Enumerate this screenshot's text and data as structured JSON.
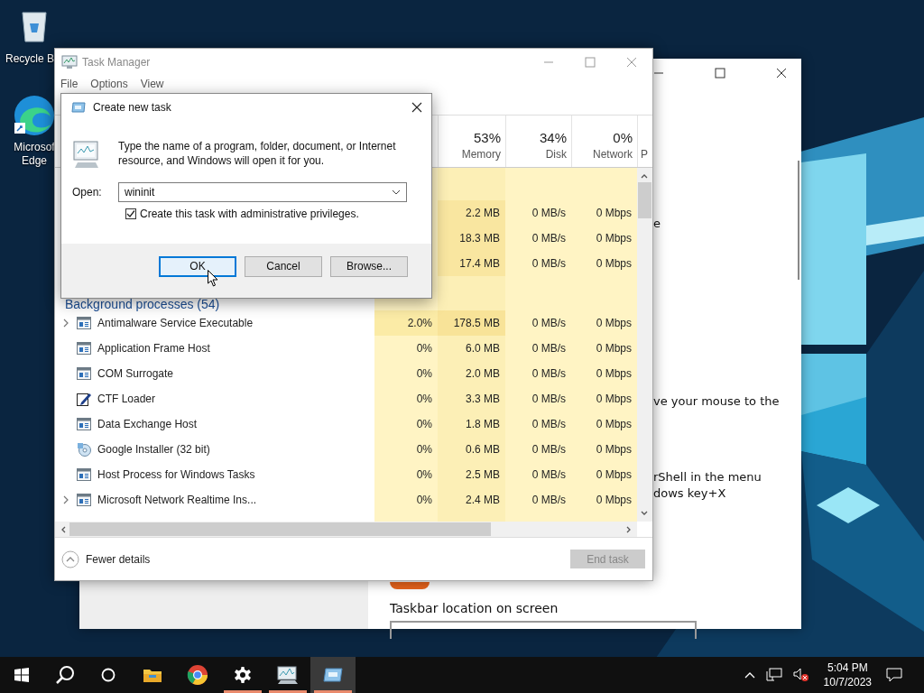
{
  "desktop_icons": [
    {
      "kind": "bin",
      "label": "Recycle B"
    },
    {
      "kind": "browser",
      "label": "Microsof Edge"
    }
  ],
  "settings_window": {
    "line_fragments": [
      "e",
      "ve your mouse to the",
      "rShell in the menu",
      "dows key+X"
    ],
    "toggle": {
      "on": true
    },
    "heading": "Taskbar location on screen"
  },
  "task_manager": {
    "title": "Task Manager",
    "menu": [
      "File",
      "Options",
      "View"
    ],
    "columns": [
      {
        "value": "53%",
        "label": "Memory"
      },
      {
        "value": "34%",
        "label": "Disk"
      },
      {
        "value": "0%",
        "label": "Network"
      },
      {
        "label": "P"
      }
    ],
    "apps_rows": [
      {
        "memory": "2.2 MB",
        "disk": "0 MB/s",
        "network": "0 Mbps"
      },
      {
        "memory": "18.3 MB",
        "disk": "0 MB/s",
        "network": "0 Mbps"
      },
      {
        "memory": "17.4 MB",
        "disk": "0 MB/s",
        "network": "0 Mbps"
      }
    ],
    "group_heading": "Background processes (54)",
    "rows": [
      {
        "name": "Antimalware Service Executable",
        "kind": "window",
        "expandable": true,
        "cpu": "2.0%",
        "memory": "178.5 MB",
        "disk": "0 MB/s",
        "network": "0 Mbps"
      },
      {
        "name": "Application Frame Host",
        "kind": "window",
        "expandable": false,
        "cpu": "0%",
        "memory": "6.0 MB",
        "disk": "0 MB/s",
        "network": "0 Mbps"
      },
      {
        "name": "COM Surrogate",
        "kind": "window",
        "expandable": false,
        "cpu": "0%",
        "memory": "2.0 MB",
        "disk": "0 MB/s",
        "network": "0 Mbps"
      },
      {
        "name": "CTF Loader",
        "kind": "pen",
        "expandable": false,
        "cpu": "0%",
        "memory": "3.3 MB",
        "disk": "0 MB/s",
        "network": "0 Mbps"
      },
      {
        "name": "Data Exchange Host",
        "kind": "window",
        "expandable": false,
        "cpu": "0%",
        "memory": "1.8 MB",
        "disk": "0 MB/s",
        "network": "0 Mbps"
      },
      {
        "name": "Google Installer (32 bit)",
        "kind": "installer",
        "expandable": false,
        "cpu": "0%",
        "memory": "0.6 MB",
        "disk": "0 MB/s",
        "network": "0 Mbps"
      },
      {
        "name": "Host Process for Windows Tasks",
        "kind": "window",
        "expandable": false,
        "cpu": "0%",
        "memory": "2.5 MB",
        "disk": "0 MB/s",
        "network": "0 Mbps"
      },
      {
        "name": "Microsoft Network Realtime Ins...",
        "kind": "window",
        "expandable": true,
        "cpu": "0%",
        "memory": "2.4 MB",
        "disk": "0 MB/s",
        "network": "0 Mbps"
      }
    ],
    "fewer_details": "Fewer details",
    "end_task": {
      "label": "End task",
      "disabled": true
    }
  },
  "dialog": {
    "title": "Create new task",
    "message": "Type the name of a program, folder, document, or Internet resource, and Windows will open it for you.",
    "open_label": "Open:",
    "open_value": "wininit",
    "admin": {
      "label": "Create this task with administrative privileges.",
      "checked": true
    },
    "buttons": [
      {
        "label": "OK",
        "focused": true
      },
      {
        "label": "Cancel",
        "focused": false
      },
      {
        "label": "Browse...",
        "focused": false
      }
    ]
  },
  "taskbar": {
    "items": [
      {
        "kind": "start",
        "running": false,
        "selected": false
      },
      {
        "kind": "search",
        "running": false,
        "selected": false
      },
      {
        "kind": "cortana",
        "running": false,
        "selected": false
      },
      {
        "kind": "folder",
        "running": false,
        "selected": false
      },
      {
        "kind": "browser",
        "running": false,
        "selected": false
      },
      {
        "kind": "settings",
        "running": true,
        "selected": false
      },
      {
        "kind": "monitor",
        "running": true,
        "selected": false
      },
      {
        "kind": "run",
        "running": true,
        "selected": true
      }
    ],
    "clock": {
      "time": "5:04 PM",
      "date": "10/7/2023"
    }
  }
}
